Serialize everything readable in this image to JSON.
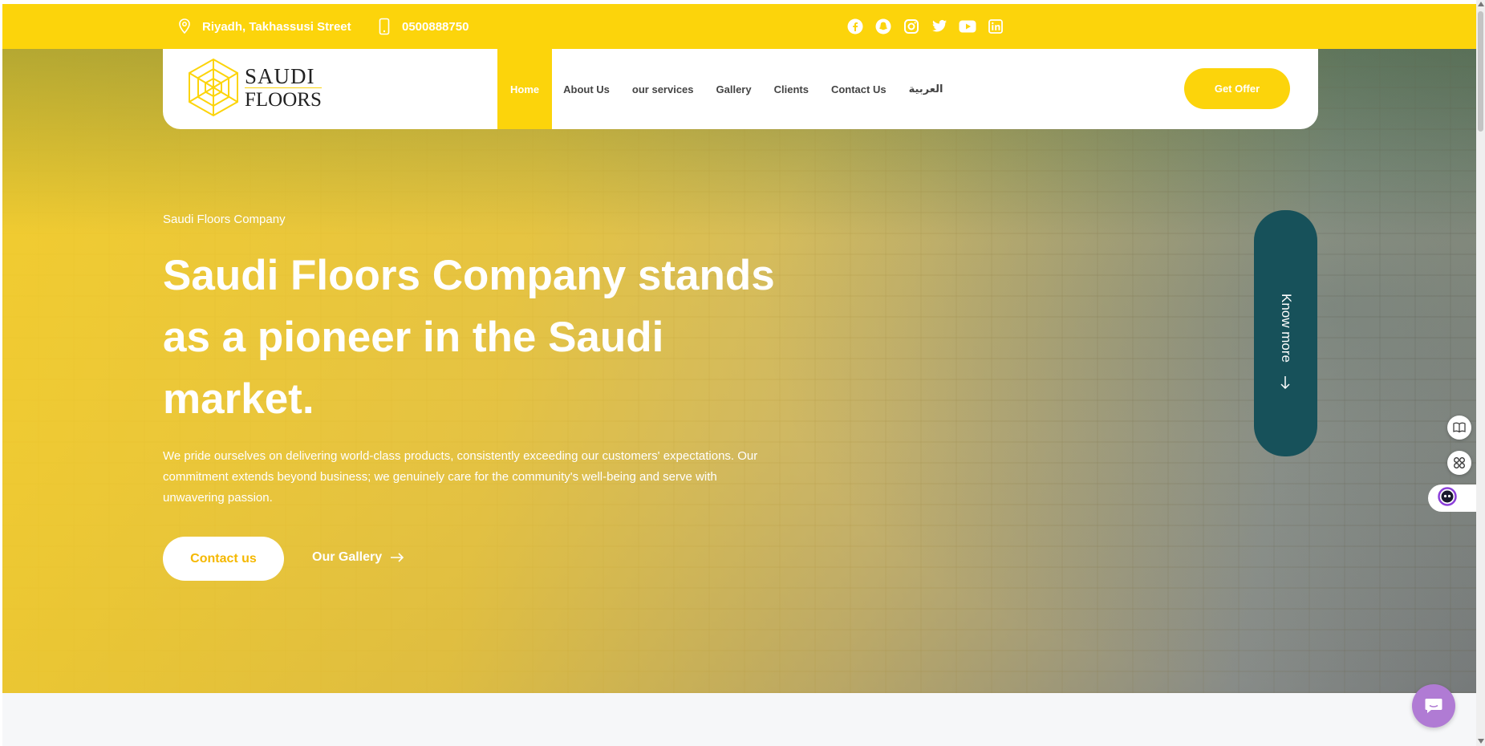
{
  "topbar": {
    "location": "Riyadh, Takhassusi Street",
    "phone": "0500888750",
    "location_icon": "map-pin-icon",
    "phone_icon": "mobile-phone-icon",
    "socials": [
      "facebook-icon",
      "snapchat-icon",
      "instagram-icon",
      "twitter-icon",
      "youtube-icon",
      "linkedin-icon"
    ]
  },
  "header": {
    "logo_line1": "SAUDI",
    "logo_line2": "FLOORS",
    "nav": [
      "Home",
      "About Us",
      "our services",
      "Gallery",
      "Clients",
      "Contact Us",
      "العربية"
    ],
    "active_nav": "Home",
    "cta": "Get Offer"
  },
  "hero": {
    "eyebrow": "Saudi Floors Company",
    "headline": "Saudi Floors Company stands as a pioneer in the Saudi market.",
    "lead": "We pride ourselves on delivering world-class products, consistently exceeding our customers' expectations. Our commitment extends beyond business; we genuinely care for the community's well-being and serve with unwavering passion.",
    "primary_button": "Contact us",
    "secondary_link": "Our Gallery",
    "know_more": "Know more"
  },
  "colors": {
    "brand_yellow": "#fcd40b",
    "teal": "#17515a",
    "chat_purple": "#b07bd4"
  }
}
